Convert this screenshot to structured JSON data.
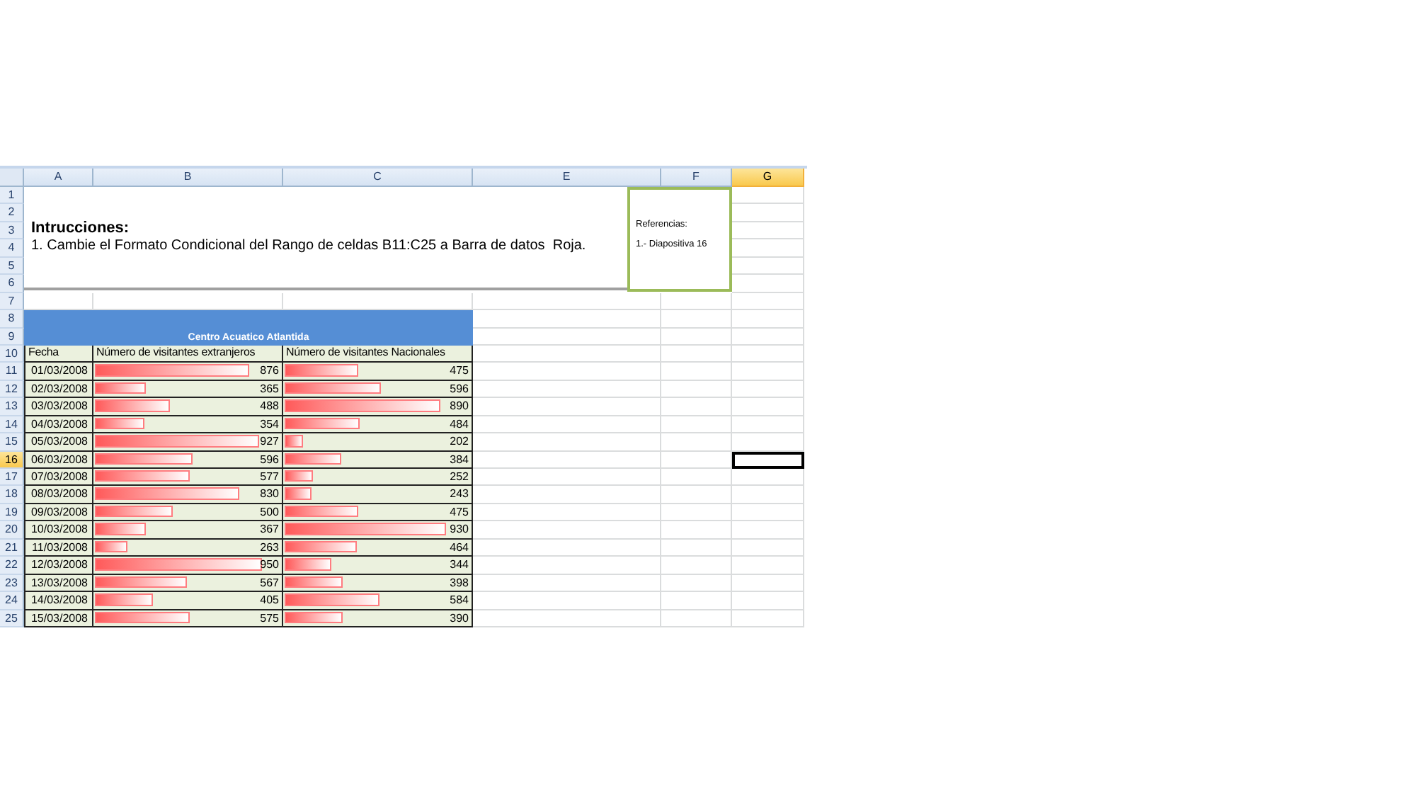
{
  "column_headers": [
    {
      "label": "A",
      "selected": false
    },
    {
      "label": "B",
      "selected": false
    },
    {
      "label": "C",
      "selected": false
    },
    {
      "label": "E",
      "selected": false
    },
    {
      "label": "F",
      "selected": false
    },
    {
      "label": "G",
      "selected": true
    }
  ],
  "row_headers": [
    {
      "label": "1",
      "selected": false
    },
    {
      "label": "2",
      "selected": false
    },
    {
      "label": "3",
      "selected": false
    },
    {
      "label": "4",
      "selected": false
    },
    {
      "label": "5",
      "selected": false
    },
    {
      "label": "6",
      "selected": false
    },
    {
      "label": "7",
      "selected": false
    },
    {
      "label": "8",
      "selected": false
    },
    {
      "label": "9",
      "selected": false
    },
    {
      "label": "10",
      "selected": false
    },
    {
      "label": "11",
      "selected": false
    },
    {
      "label": "12",
      "selected": false
    },
    {
      "label": "13",
      "selected": false
    },
    {
      "label": "14",
      "selected": false
    },
    {
      "label": "15",
      "selected": false
    },
    {
      "label": "16",
      "selected": true
    },
    {
      "label": "17",
      "selected": false
    },
    {
      "label": "18",
      "selected": false
    },
    {
      "label": "19",
      "selected": false
    },
    {
      "label": "20",
      "selected": false
    },
    {
      "label": "21",
      "selected": false
    },
    {
      "label": "22",
      "selected": false
    },
    {
      "label": "23",
      "selected": false
    },
    {
      "label": "24",
      "selected": false
    },
    {
      "label": "25",
      "selected": false
    }
  ],
  "instructions": {
    "title": "Intrucciones:",
    "text": "1. Cambie el Formato Condicional del Rango de celdas B11:C25 a Barra de datos  Roja."
  },
  "references": {
    "title": "Referencias:",
    "item": "1.- Diapositiva 16"
  },
  "table": {
    "title": "Centro Acuatico Atlantida",
    "columns": [
      "Fecha",
      "Número de visitantes extranjeros",
      "Número de visitantes Nacionales"
    ],
    "rows": [
      {
        "date": "01/03/2008",
        "foreign": {
          "value": "876",
          "level": 0.82
        },
        "national": {
          "value": "475",
          "level": 0.39
        }
      },
      {
        "date": "02/03/2008",
        "foreign": {
          "value": "365",
          "level": 0.27
        },
        "national": {
          "value": "596",
          "level": 0.51
        }
      },
      {
        "date": "03/03/2008",
        "foreign": {
          "value": "488",
          "level": 0.4
        },
        "national": {
          "value": "890",
          "level": 0.83
        }
      },
      {
        "date": "04/03/2008",
        "foreign": {
          "value": "354",
          "level": 0.26
        },
        "national": {
          "value": "484",
          "level": 0.4
        }
      },
      {
        "date": "05/03/2008",
        "foreign": {
          "value": "927",
          "level": 0.87
        },
        "national": {
          "value": "202",
          "level": 0.1
        }
      },
      {
        "date": "06/03/2008",
        "foreign": {
          "value": "596",
          "level": 0.52
        },
        "national": {
          "value": "384",
          "level": 0.3
        }
      },
      {
        "date": "07/03/2008",
        "foreign": {
          "value": "577",
          "level": 0.5
        },
        "national": {
          "value": "252",
          "level": 0.15
        }
      },
      {
        "date": "08/03/2008",
        "foreign": {
          "value": "830",
          "level": 0.77
        },
        "national": {
          "value": "243",
          "level": 0.14
        }
      },
      {
        "date": "09/03/2008",
        "foreign": {
          "value": "500",
          "level": 0.41
        },
        "national": {
          "value": "475",
          "level": 0.39
        }
      },
      {
        "date": "10/03/2008",
        "foreign": {
          "value": "367",
          "level": 0.27
        },
        "national": {
          "value": "930",
          "level": 0.86
        }
      },
      {
        "date": "11/03/2008",
        "foreign": {
          "value": "263",
          "level": 0.17
        },
        "national": {
          "value": "464",
          "level": 0.38
        }
      },
      {
        "date": "12/03/2008",
        "foreign": {
          "value": "950",
          "level": 0.89
        },
        "national": {
          "value": "344",
          "level": 0.25
        }
      },
      {
        "date": "13/03/2008",
        "foreign": {
          "value": "567",
          "level": 0.49
        },
        "national": {
          "value": "398",
          "level": 0.31
        }
      },
      {
        "date": "14/03/2008",
        "foreign": {
          "value": "405",
          "level": 0.31
        },
        "national": {
          "value": "584",
          "level": 0.5
        }
      },
      {
        "date": "15/03/2008",
        "foreign": {
          "value": "575",
          "level": 0.5
        },
        "national": {
          "value": "390",
          "level": 0.31
        }
      }
    ]
  }
}
